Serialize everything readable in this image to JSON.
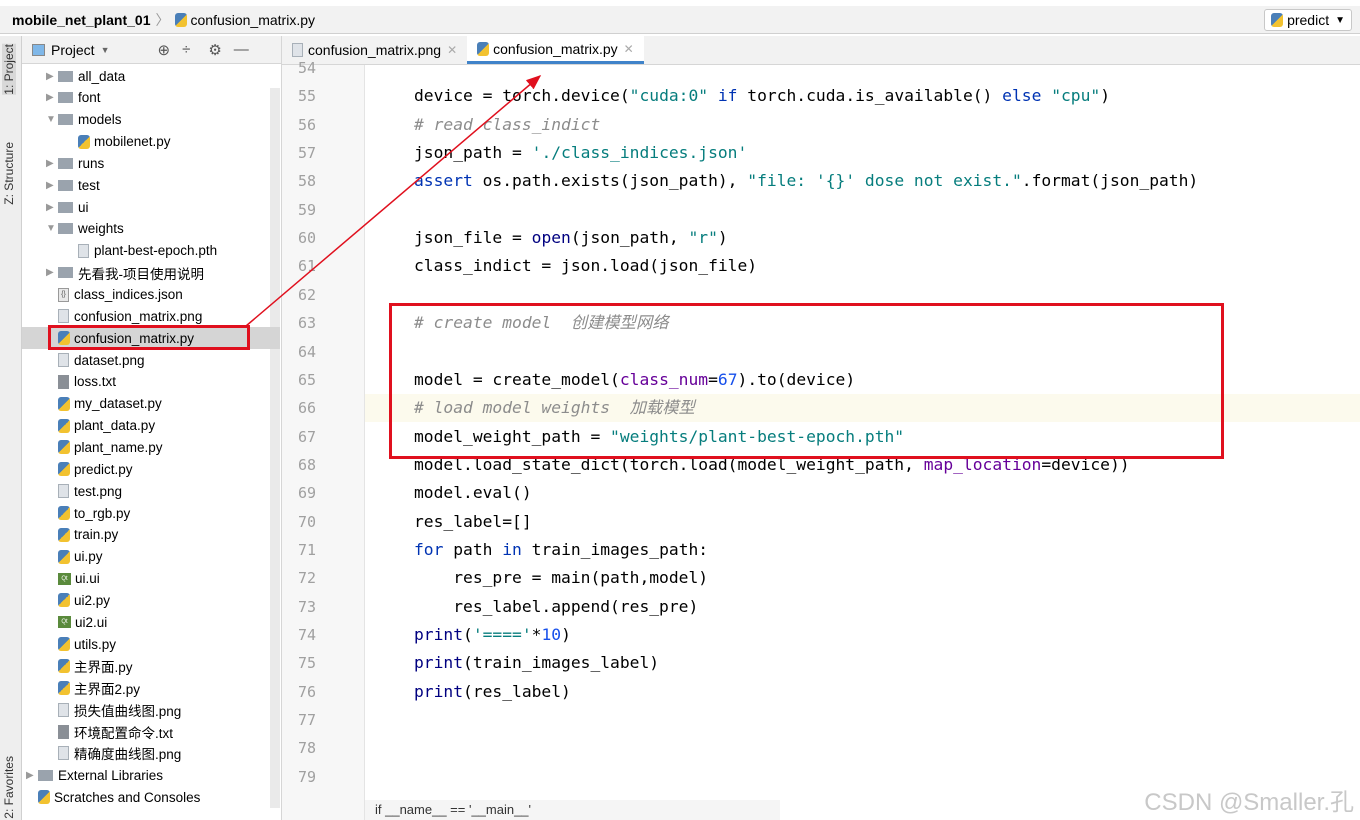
{
  "breadcrumb": {
    "project": "mobile_net_plant_01",
    "file": "confusion_matrix.py"
  },
  "run_config": "predict",
  "left_strip": {
    "project": "1: Project",
    "structure": "Z: Structure",
    "favorites": "2: Favorites"
  },
  "panel": {
    "title": "Project"
  },
  "tree": [
    {
      "label": "all_data",
      "type": "folder",
      "level": 1,
      "arrow": "▶"
    },
    {
      "label": "font",
      "type": "folder",
      "level": 1,
      "arrow": "▶"
    },
    {
      "label": "models",
      "type": "folder",
      "level": 1,
      "arrow": "▼"
    },
    {
      "label": "mobilenet.py",
      "type": "py",
      "level": 2
    },
    {
      "label": "runs",
      "type": "folder",
      "level": 1,
      "arrow": "▶"
    },
    {
      "label": "test",
      "type": "folder",
      "level": 1,
      "arrow": "▶"
    },
    {
      "label": "ui",
      "type": "folder",
      "level": 1,
      "arrow": "▶"
    },
    {
      "label": "weights",
      "type": "folder",
      "level": 1,
      "arrow": "▼"
    },
    {
      "label": "plant-best-epoch.pth",
      "type": "file",
      "level": 2
    },
    {
      "label": "先看我-项目使用说明",
      "type": "folder",
      "level": 1,
      "arrow": "▶"
    },
    {
      "label": "class_indices.json",
      "type": "json",
      "level": 1
    },
    {
      "label": "confusion_matrix.png",
      "type": "file",
      "level": 1
    },
    {
      "label": "confusion_matrix.py",
      "type": "py",
      "level": 1,
      "selected": true
    },
    {
      "label": "dataset.png",
      "type": "file",
      "level": 1
    },
    {
      "label": "loss.txt",
      "type": "txt",
      "level": 1
    },
    {
      "label": "my_dataset.py",
      "type": "py",
      "level": 1
    },
    {
      "label": "plant_data.py",
      "type": "py",
      "level": 1
    },
    {
      "label": "plant_name.py",
      "type": "py",
      "level": 1
    },
    {
      "label": "predict.py",
      "type": "py",
      "level": 1
    },
    {
      "label": "test.png",
      "type": "file",
      "level": 1
    },
    {
      "label": "to_rgb.py",
      "type": "py",
      "level": 1
    },
    {
      "label": "train.py",
      "type": "py",
      "level": 1
    },
    {
      "label": "ui.py",
      "type": "py",
      "level": 1
    },
    {
      "label": "ui.ui",
      "type": "ui",
      "level": 1
    },
    {
      "label": "ui2.py",
      "type": "py",
      "level": 1
    },
    {
      "label": "ui2.ui",
      "type": "ui",
      "level": 1
    },
    {
      "label": "utils.py",
      "type": "py",
      "level": 1
    },
    {
      "label": "主界面.py",
      "type": "py",
      "level": 1
    },
    {
      "label": "主界面2.py",
      "type": "py",
      "level": 1
    },
    {
      "label": "损失值曲线图.png",
      "type": "file",
      "level": 1
    },
    {
      "label": "环境配置命令.txt",
      "type": "txt",
      "level": 1
    },
    {
      "label": "精确度曲线图.png",
      "type": "file",
      "level": 1
    },
    {
      "label": "External Libraries",
      "type": "lib",
      "level": 0,
      "arrow": "▶"
    },
    {
      "label": "Scratches and Consoles",
      "type": "scratch",
      "level": 0
    }
  ],
  "tabs": [
    {
      "label": "confusion_matrix.png",
      "type": "file"
    },
    {
      "label": "confusion_matrix.py",
      "type": "py",
      "active": true
    }
  ],
  "code": [
    {
      "n": "54",
      "t": []
    },
    {
      "n": "55",
      "t": [
        [
          "device = torch.device(",
          ""
        ],
        [
          "\"cuda:0\"",
          "str"
        ],
        [
          " if ",
          "kw"
        ],
        [
          "torch.cuda.is_available() ",
          ""
        ],
        [
          "else",
          "kw"
        ],
        [
          " ",
          ""
        ],
        [
          "\"cpu\"",
          "str"
        ],
        [
          ")",
          ""
        ]
      ]
    },
    {
      "n": "56",
      "t": [
        [
          "# read class_indict",
          "cm"
        ]
      ]
    },
    {
      "n": "57",
      "t": [
        [
          "json_path = ",
          ""
        ],
        [
          "'./class_indices.json'",
          "str"
        ]
      ]
    },
    {
      "n": "58",
      "t": [
        [
          "assert",
          "kw"
        ],
        [
          " os.path.exists(json_path), ",
          ""
        ],
        [
          "\"file: '{}' dose not exist.\"",
          "str"
        ],
        [
          ".format(json_path)",
          ""
        ]
      ]
    },
    {
      "n": "59",
      "t": []
    },
    {
      "n": "60",
      "t": [
        [
          "json_file = ",
          ""
        ],
        [
          "open",
          "bi"
        ],
        [
          "(json_path, ",
          ""
        ],
        [
          "\"r\"",
          "str"
        ],
        [
          ")",
          ""
        ]
      ]
    },
    {
      "n": "61",
      "t": [
        [
          "class_indict = json.load(json_file)",
          ""
        ]
      ]
    },
    {
      "n": "62",
      "t": []
    },
    {
      "n": "63",
      "t": [
        [
          "# create model  创建模型网络",
          "cm"
        ]
      ]
    },
    {
      "n": "64",
      "t": []
    },
    {
      "n": "65",
      "t": [
        [
          "model = create_model(",
          ""
        ],
        [
          "class_num",
          "par"
        ],
        [
          "=",
          ""
        ],
        [
          "67",
          "num"
        ],
        [
          ").to(device)",
          ""
        ]
      ]
    },
    {
      "n": "66",
      "t": [
        [
          "# load model weights  加载模型",
          "cm"
        ]
      ],
      "hl": true
    },
    {
      "n": "67",
      "t": [
        [
          "model_weight_path = ",
          ""
        ],
        [
          "\"weights/plant-best-epoch.pth\"",
          "str"
        ]
      ]
    },
    {
      "n": "68",
      "t": [
        [
          "model.load_state_dict(torch.load(model_weight_path, ",
          ""
        ],
        [
          "map_location",
          "par"
        ],
        [
          "=device))",
          ""
        ]
      ]
    },
    {
      "n": "69",
      "t": [
        [
          "model.eval()",
          ""
        ]
      ]
    },
    {
      "n": "70",
      "t": [
        [
          "res_label=[]",
          ""
        ]
      ]
    },
    {
      "n": "71",
      "t": [
        [
          "for",
          "kw"
        ],
        [
          " path ",
          ""
        ],
        [
          "in",
          "kw"
        ],
        [
          " train_images_path:",
          ""
        ]
      ]
    },
    {
      "n": "72",
      "t": [
        [
          "    res_pre = main(path,model)",
          ""
        ]
      ]
    },
    {
      "n": "73",
      "t": [
        [
          "    res_label.append(res_pre)",
          ""
        ]
      ]
    },
    {
      "n": "74",
      "t": [
        [
          "print",
          "bi"
        ],
        [
          "(",
          ""
        ],
        [
          "'===='",
          "str"
        ],
        [
          "*",
          ""
        ],
        [
          "10",
          "num"
        ],
        [
          ")",
          ""
        ]
      ]
    },
    {
      "n": "75",
      "t": [
        [
          "print",
          "bi"
        ],
        [
          "(train_images_label)",
          ""
        ]
      ]
    },
    {
      "n": "76",
      "t": [
        [
          "print",
          "bi"
        ],
        [
          "(res_label)",
          ""
        ]
      ]
    },
    {
      "n": "77",
      "t": []
    },
    {
      "n": "78",
      "t": []
    },
    {
      "n": "79",
      "t": []
    }
  ],
  "status_breadcrumb": "if __name__ == '__main__'",
  "watermark": "CSDN @Smaller.孔",
  "colors": {
    "annotation": "#e0101e",
    "accent": "#4083c9"
  }
}
